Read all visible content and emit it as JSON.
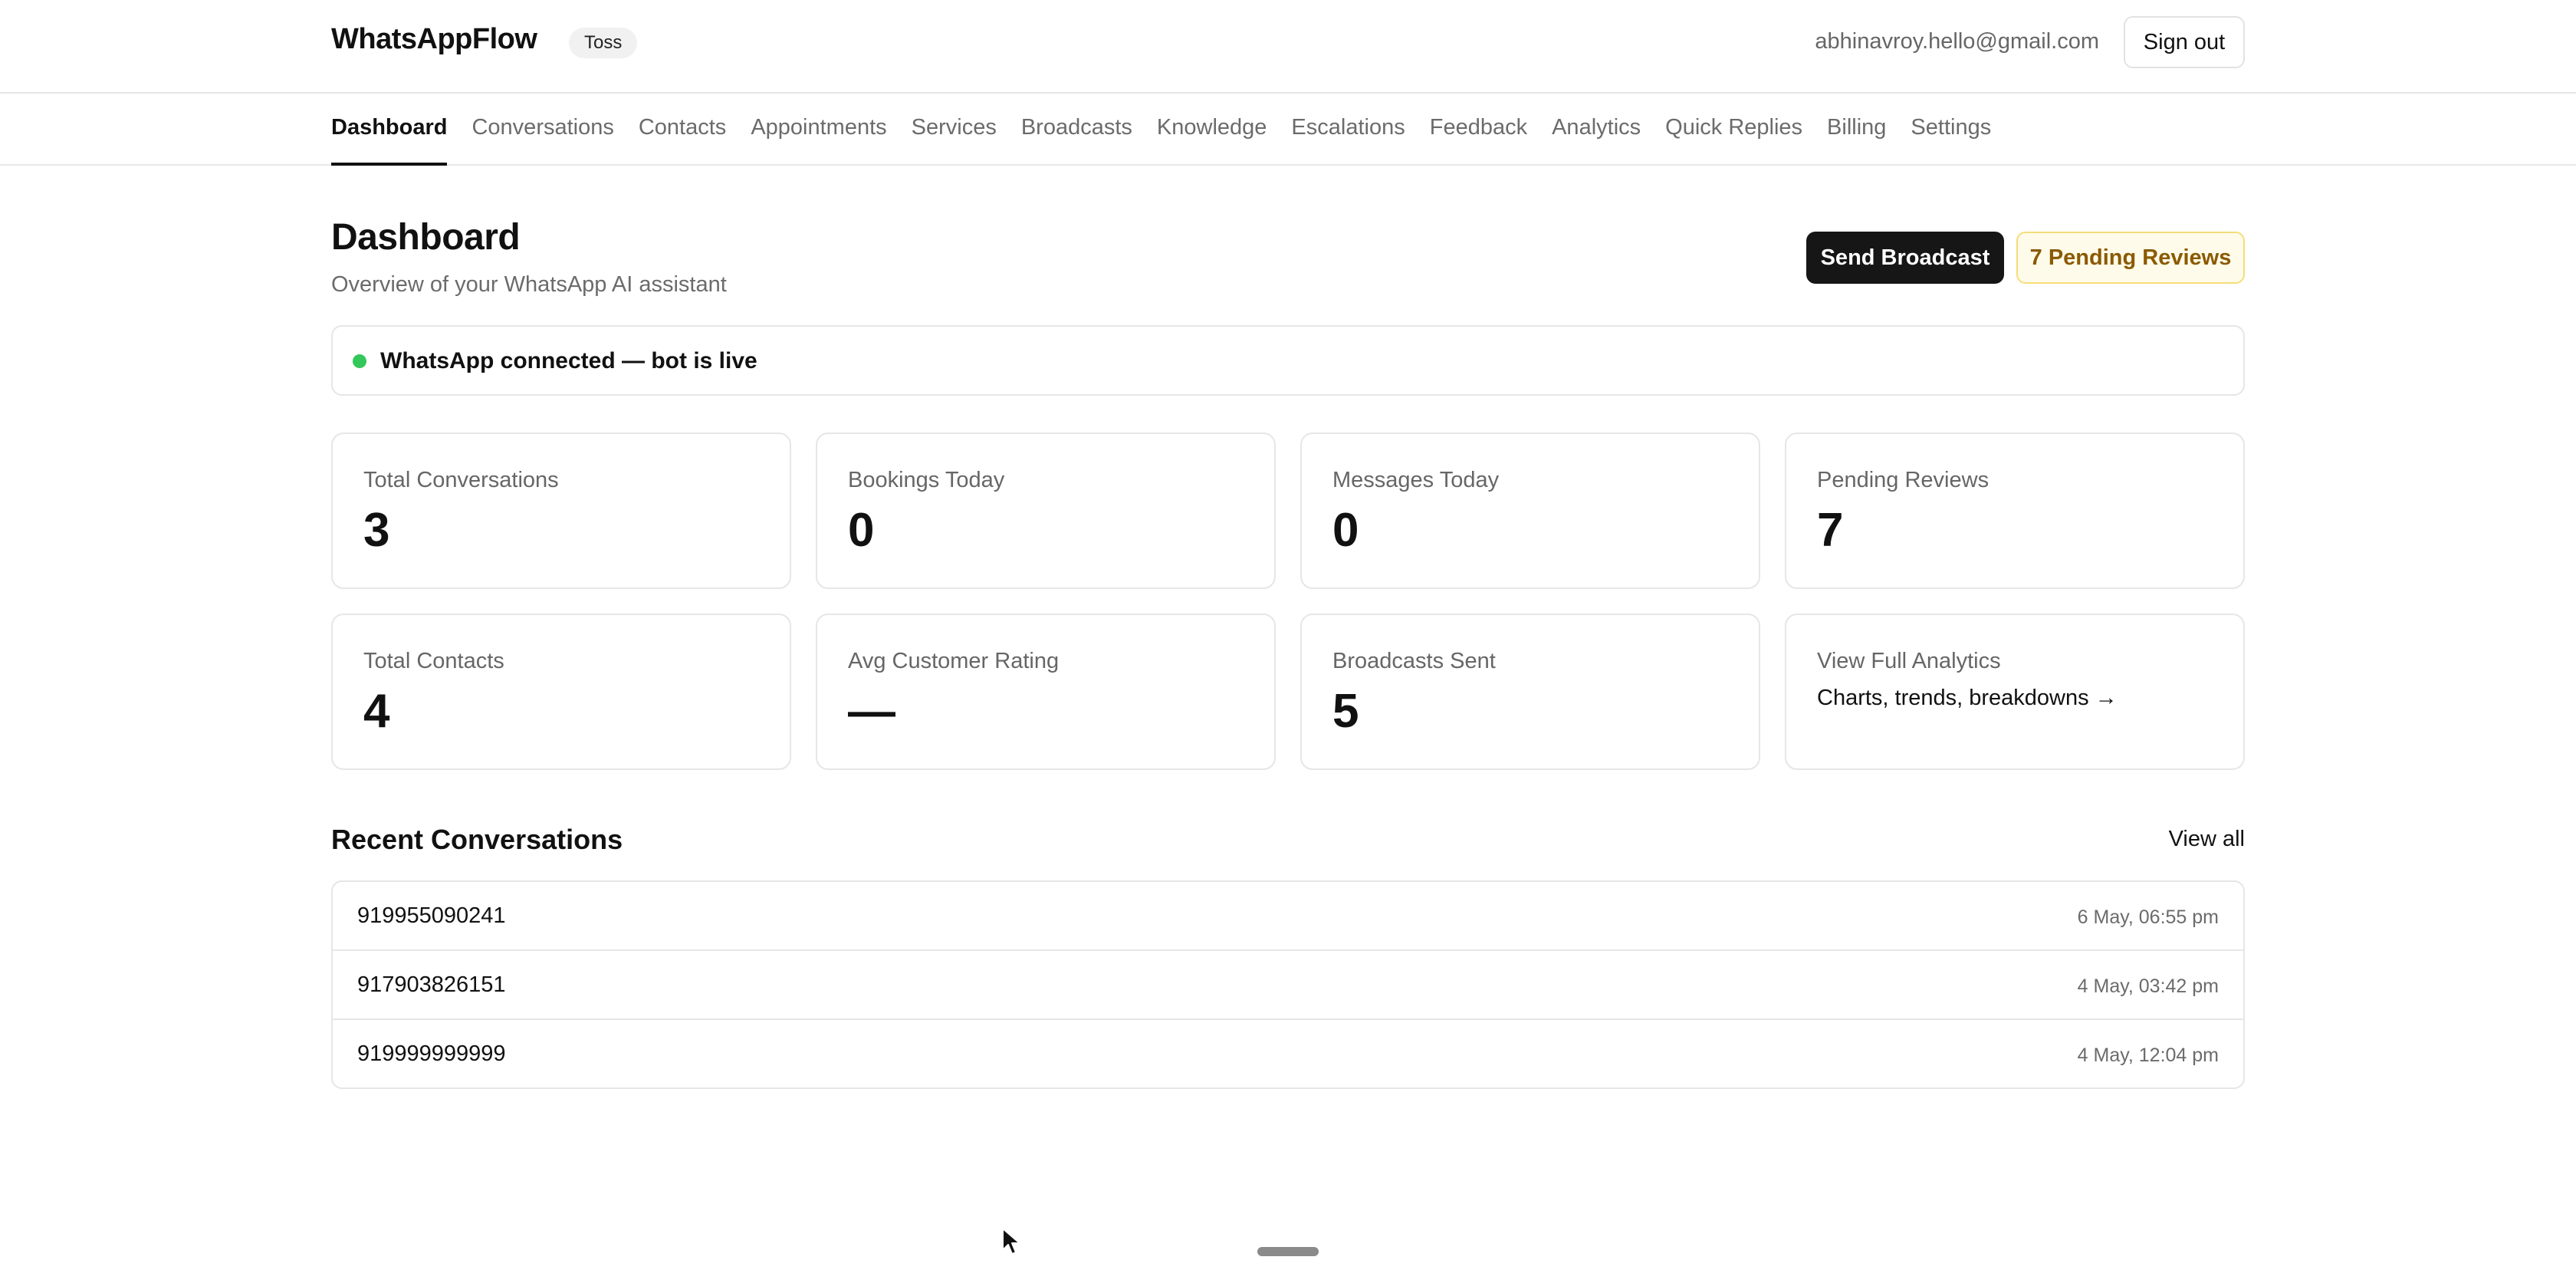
{
  "header": {
    "brand": "WhatsAppFlow",
    "org_badge": "Toss",
    "user_email": "abhinavroy.hello@gmail.com",
    "signout_label": "Sign out"
  },
  "nav": {
    "tabs": [
      {
        "label": "Dashboard",
        "active": true
      },
      {
        "label": "Conversations",
        "active": false
      },
      {
        "label": "Contacts",
        "active": false
      },
      {
        "label": "Appointments",
        "active": false
      },
      {
        "label": "Services",
        "active": false
      },
      {
        "label": "Broadcasts",
        "active": false
      },
      {
        "label": "Knowledge",
        "active": false
      },
      {
        "label": "Escalations",
        "active": false
      },
      {
        "label": "Feedback",
        "active": false
      },
      {
        "label": "Analytics",
        "active": false
      },
      {
        "label": "Quick Replies",
        "active": false
      },
      {
        "label": "Billing",
        "active": false
      },
      {
        "label": "Settings",
        "active": false
      }
    ]
  },
  "page": {
    "title": "Dashboard",
    "subtitle": "Overview of your WhatsApp AI assistant",
    "broadcast_button": "Send Broadcast",
    "pending_button": "7 Pending Reviews"
  },
  "status": {
    "text": "WhatsApp connected — bot is live",
    "dot_color": "#34c759"
  },
  "stats": {
    "total_conversations": {
      "label": "Total Conversations",
      "value": "3"
    },
    "bookings_today": {
      "label": "Bookings Today",
      "value": "0"
    },
    "messages_today": {
      "label": "Messages Today",
      "value": "0"
    },
    "pending_reviews": {
      "label": "Pending Reviews",
      "value": "7"
    },
    "total_contacts": {
      "label": "Total Contacts",
      "value": "4"
    },
    "avg_rating": {
      "label": "Avg Customer Rating",
      "value": "—"
    },
    "broadcasts_sent": {
      "label": "Broadcasts Sent",
      "value": "5"
    },
    "analytics_link": {
      "title": "View Full Analytics",
      "subtitle": "Charts, trends, breakdowns →"
    }
  },
  "recent": {
    "title": "Recent Conversations",
    "view_all": "View all",
    "rows": [
      {
        "phone": "919955090241",
        "time": "6 May, 06:55 pm"
      },
      {
        "phone": "917903826151",
        "time": "4 May, 03:42 pm"
      },
      {
        "phone": "919999999999",
        "time": "4 May, 12:04 pm"
      }
    ]
  },
  "colors": {
    "accent": "#161616",
    "warning_bg": "#fffbea",
    "warning_border": "#f5dd7a",
    "warning_text": "#8a5a00"
  }
}
